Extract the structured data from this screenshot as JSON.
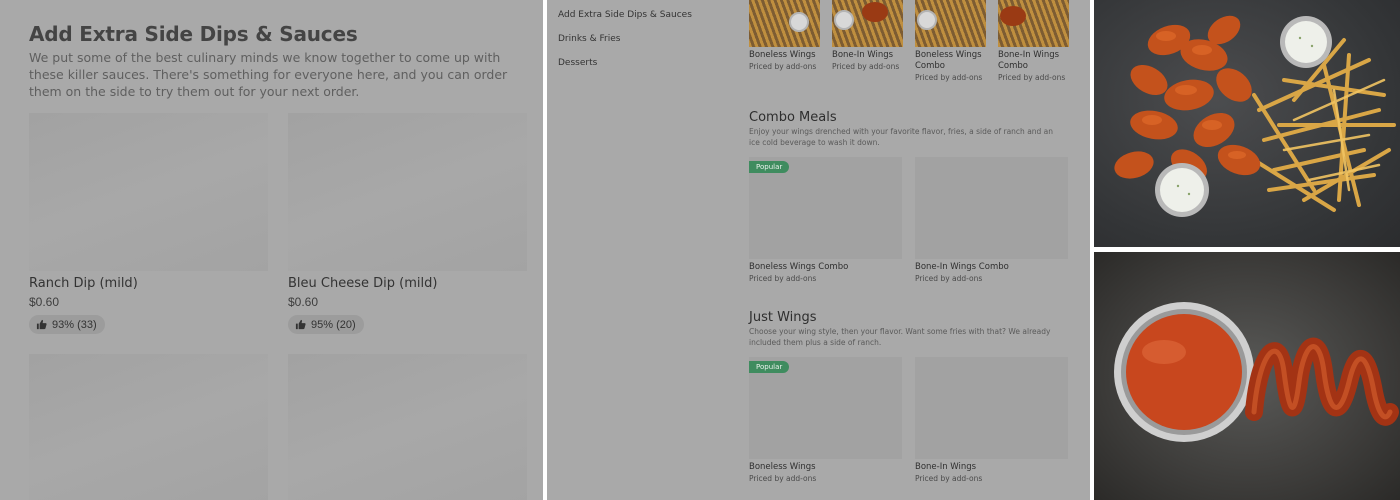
{
  "left_panel": {
    "section_title": "Add Extra Side Dips & Sauces",
    "section_description": "We put some of the best culinary minds we know together to come up with these killer sauces. There's something for everyone here, and you can order them on the side to try them out for your next order.",
    "items": [
      {
        "name": "Ranch Dip (mild)",
        "price": "$0.60",
        "rating": "93% (33)"
      },
      {
        "name": "Bleu Cheese Dip (mild)",
        "price": "$0.60",
        "rating": "95% (20)"
      }
    ]
  },
  "mid_panel": {
    "nav": [
      {
        "label": "Add Extra Side Dips & Sauces"
      },
      {
        "label": "Drinks & Fries"
      },
      {
        "label": "Desserts"
      }
    ],
    "top_items": [
      {
        "name": "Boneless Wings",
        "sub": "Priced by add-ons"
      },
      {
        "name": "Bone-In Wings",
        "sub": "Priced by add-ons"
      },
      {
        "name": "Boneless Wings Combo",
        "sub": "Priced by add-ons"
      },
      {
        "name": "Bone-In Wings Combo",
        "sub": "Priced by add-ons"
      }
    ],
    "combo": {
      "title": "Combo Meals",
      "description": "Enjoy your wings drenched with your favorite flavor, fries, a side of ranch and an ice cold beverage to wash it down.",
      "items": [
        {
          "badge": "Popular",
          "name": "Boneless Wings Combo",
          "sub": "Priced by add-ons"
        },
        {
          "badge": "",
          "name": "Bone-In Wings Combo",
          "sub": "Priced by add-ons"
        }
      ]
    },
    "wings": {
      "title": "Just Wings",
      "description": "Choose your wing style, then your flavor. Want some fries with that? We already included them plus a side of ranch.",
      "items": [
        {
          "badge": "Popular",
          "name": "Boneless Wings",
          "sub": "Priced by add-ons"
        },
        {
          "badge": "",
          "name": "Bone-In Wings",
          "sub": "Priced by add-ons"
        }
      ]
    }
  },
  "colors": {
    "badge_green": "#3f8c5f",
    "overlay_gray": "#a9a9a9"
  }
}
